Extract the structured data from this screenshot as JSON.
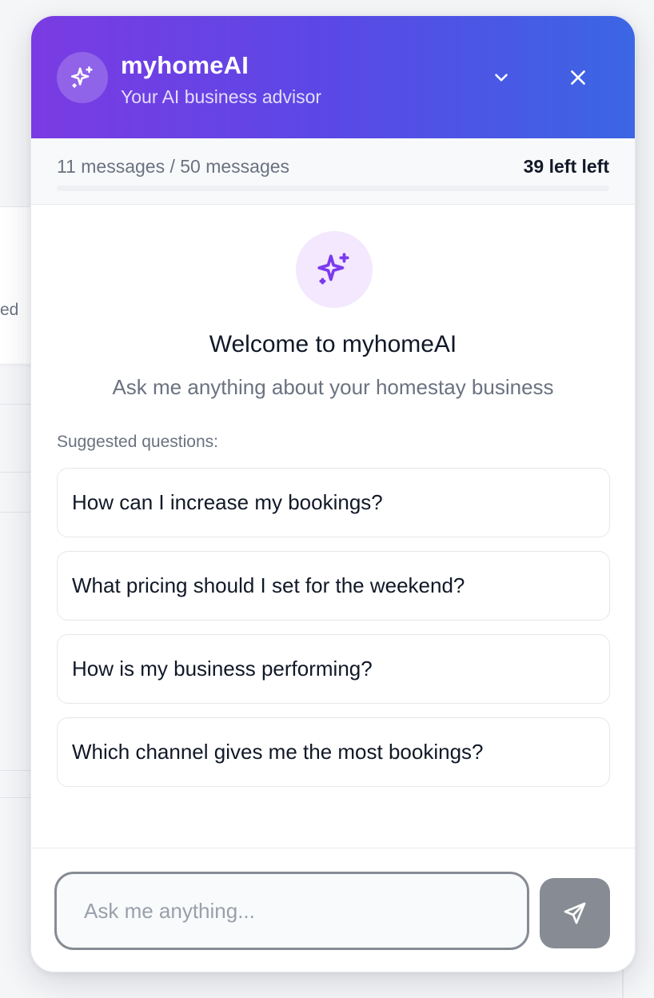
{
  "background": {
    "partial_text": "ed"
  },
  "header": {
    "title": "myhomeAI",
    "subtitle": "Your AI business advisor",
    "avatar_icon": "sparkles-icon",
    "collapse_icon": "chevron-down-icon",
    "close_icon": "close-icon"
  },
  "usage": {
    "text": "11 messages / 50 messages",
    "remaining": "39 left left",
    "used": 11,
    "limit": 50
  },
  "welcome": {
    "icon": "sparkles-icon",
    "title": "Welcome to myhomeAI",
    "subtitle": "Ask me anything about your homestay business"
  },
  "suggestions": {
    "label": "Suggested questions:",
    "items": [
      "How can I increase my bookings?",
      "What pricing should I set for the weekend?",
      "How is my business performing?",
      "Which channel gives me the most bookings?"
    ]
  },
  "composer": {
    "placeholder": "Ask me anything...",
    "value": "",
    "send_icon": "send-icon"
  },
  "colors": {
    "header_gradient_start": "#7b3be3",
    "header_gradient_end": "#3b66e4",
    "accent_purple": "#7c3aed",
    "send_button": "#878c94"
  }
}
